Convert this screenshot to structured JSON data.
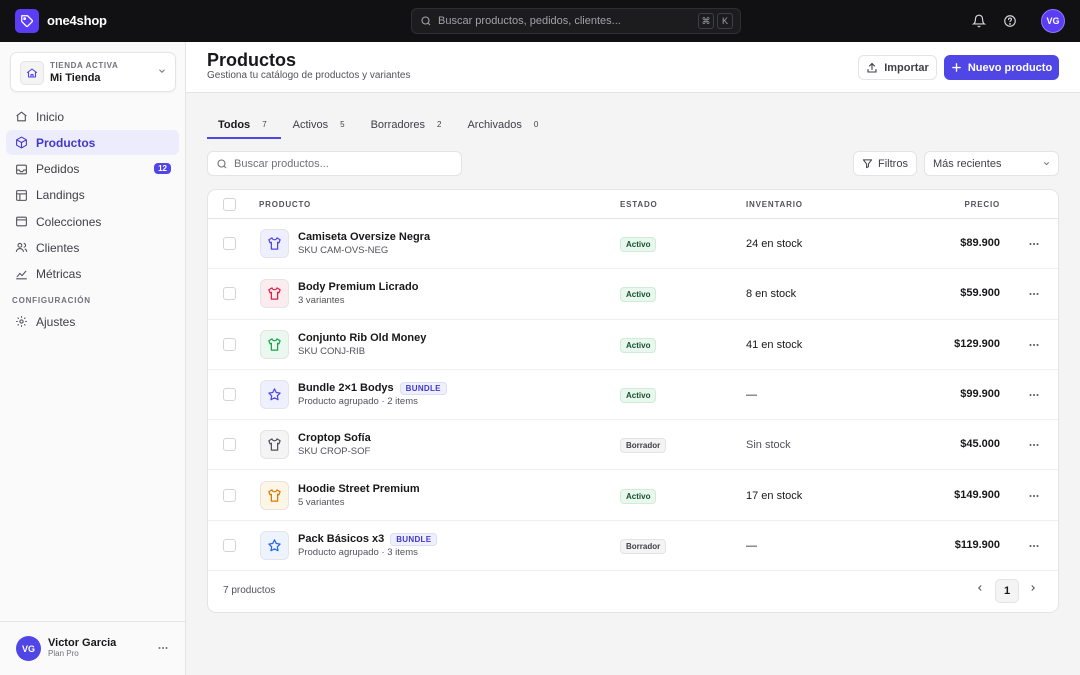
{
  "app": {
    "name": "one4shop",
    "user_initials": "VG"
  },
  "global_search": {
    "placeholder": "Buscar productos, pedidos, clientes...",
    "shortcut_mod": "⌘",
    "shortcut_key": "K"
  },
  "store": {
    "kicker": "TIENDA ACTIVA",
    "name": "Mi Tienda"
  },
  "sidebar": {
    "items": [
      {
        "label": "Inicio",
        "icon": "home-icon"
      },
      {
        "label": "Productos",
        "icon": "box-icon",
        "active": true
      },
      {
        "label": "Pedidos",
        "icon": "inbox-icon",
        "badge": "12"
      },
      {
        "label": "Landings",
        "icon": "layout-icon"
      },
      {
        "label": "Colecciones",
        "icon": "folder-icon"
      },
      {
        "label": "Clientes",
        "icon": "users-icon"
      },
      {
        "label": "Métricas",
        "icon": "chart-icon"
      }
    ],
    "section_label": "CONFIGURACIÓN",
    "settings_label": "Ajustes"
  },
  "user": {
    "initials": "VG",
    "name": "Victor Garcia",
    "plan": "Plan Pro"
  },
  "header": {
    "title": "Productos",
    "subtitle": "Gestiona tu catálogo de productos y variantes",
    "import_label": "Importar",
    "new_label": "Nuevo producto"
  },
  "tabs": [
    {
      "label": "Todos",
      "count": "7",
      "active": true
    },
    {
      "label": "Activos",
      "count": "5"
    },
    {
      "label": "Borradores",
      "count": "2"
    },
    {
      "label": "Archivados",
      "count": "0"
    }
  ],
  "toolbar": {
    "search_placeholder": "Buscar productos...",
    "filters_label": "Filtros",
    "sort_value": "Más recientes"
  },
  "table": {
    "columns": {
      "product": "PRODUCTO",
      "status": "ESTADO",
      "inventory": "INVENTARIO",
      "price": "PRECIO"
    },
    "rows": [
      {
        "name": "Camiseta Oversize Negra",
        "sub": "SKU CAM-OVS-NEG",
        "status": "Activo",
        "inventory": "24 en stock",
        "price": "$89.900",
        "icon": "shirt-icon",
        "thumb_bg": "#eef0ff",
        "icon_color": "#4f46e5"
      },
      {
        "name": "Body Premium Licrado",
        "sub": "3 variantes",
        "status": "Activo",
        "inventory": "8 en stock",
        "price": "$59.900",
        "icon": "shirt-icon",
        "thumb_bg": "#fdecef",
        "icon_color": "#e11d48"
      },
      {
        "name": "Conjunto Rib Old Money",
        "sub": "SKU CONJ-RIB",
        "status": "Activo",
        "inventory": "41 en stock",
        "price": "$129.900",
        "icon": "shirt-icon",
        "thumb_bg": "#ebf8ef",
        "icon_color": "#16a34a"
      },
      {
        "name": "Bundle 2×1 Bodys",
        "bundle_tag": "BUNDLE",
        "sub": "Producto agrupado · 2 items",
        "status": "Activo",
        "inventory": "—",
        "price": "$99.900",
        "icon": "star-icon",
        "thumb_bg": "#eef0ff",
        "icon_color": "#4f46e5"
      },
      {
        "name": "Croptop Sofía",
        "sub": "SKU CROP-SOF",
        "status": "Borrador",
        "inventory": "Sin stock",
        "price": "$45.000",
        "icon": "shirt-icon",
        "thumb_bg": "#f4f4f5",
        "icon_color": "#52525b"
      },
      {
        "name": "Hoodie Street Premium",
        "sub": "5 variantes",
        "status": "Activo",
        "inventory": "17 en stock",
        "price": "$149.900",
        "icon": "shirt-icon",
        "thumb_bg": "#fef6e4",
        "icon_color": "#d97706"
      },
      {
        "name": "Pack Básicos x3",
        "bundle_tag": "BUNDLE",
        "sub": "Producto agrupado · 3 items",
        "status": "Borrador",
        "inventory": "—",
        "price": "$119.900",
        "icon": "star-icon",
        "thumb_bg": "#eef4ff",
        "icon_color": "#2563eb"
      }
    ],
    "footer_count": "7 productos",
    "page": "1"
  },
  "colors": {
    "accent": "#4f46e5",
    "topbar": "#111113",
    "logo": "#5b3df5"
  }
}
